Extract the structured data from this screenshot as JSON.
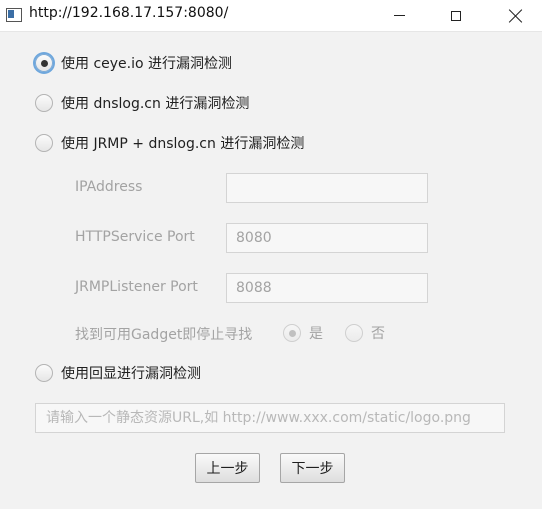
{
  "window": {
    "title": "http://192.168.17.157:8080/",
    "app_icon": "window-app-icon",
    "controls": {
      "minimize": "minimize-icon",
      "maximize": "maximize-icon",
      "close": "close-icon"
    }
  },
  "options": [
    {
      "label": "使用 ceye.io 进行漏洞检测",
      "selected": true
    },
    {
      "label": "使用 dnslog.cn 进行漏洞检测",
      "selected": false
    },
    {
      "label": "使用 JRMP + dnslog.cn 进行漏洞检测",
      "selected": false
    },
    {
      "label": "使用回显进行漏洞检测",
      "selected": false
    }
  ],
  "jrmp": {
    "ip_label": "IPAddress",
    "ip_value": "",
    "http_port_label": "HTTPService Port",
    "http_port_value": "8080",
    "jrmp_port_label": "JRMPListener Port",
    "jrmp_port_value": "8088",
    "stop_label": "找到可用Gadget即停止寻找",
    "stop_yes": "是",
    "stop_no": "否",
    "stop_selected": "是"
  },
  "echo": {
    "url_placeholder": "请输入一个静态资源URL,如 http://www.xxx.com/static/logo.png",
    "url_value": ""
  },
  "buttons": {
    "prev": "上一步",
    "next": "下一步"
  },
  "colors": {
    "disabled_text": "#a3a3a3",
    "focus_ring": "#6ea7dd",
    "background": "#f2f2f2"
  }
}
